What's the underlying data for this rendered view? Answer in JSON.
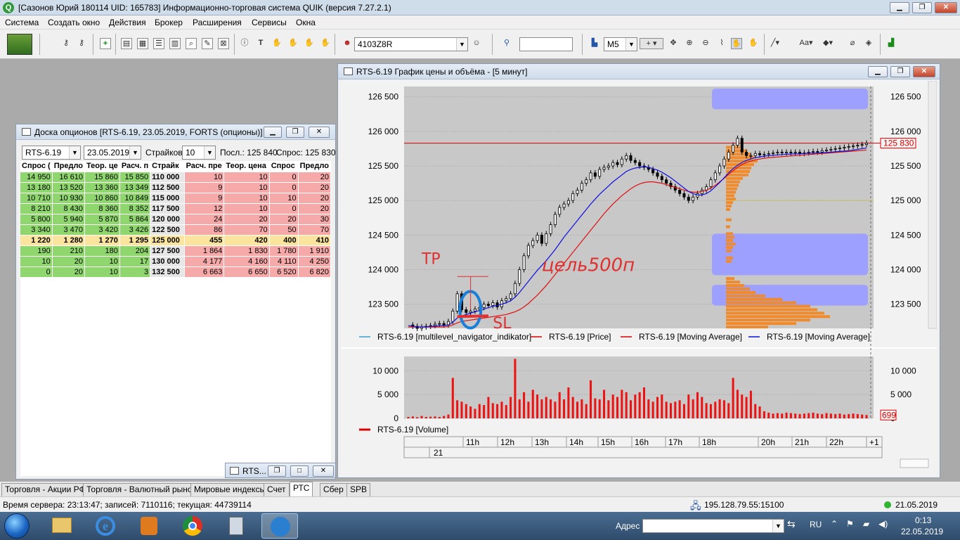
{
  "app": {
    "title": "[Сазонов Юрий 180114 UID: 165783] Информационно-торговая система QUIK (версия 7.27.2.1)"
  },
  "menu": [
    "Система",
    "Создать окно",
    "Действия",
    "Брокер",
    "Расширения",
    "Сервисы",
    "Окна"
  ],
  "toolbar": {
    "account": "4103Z8R",
    "interval": "M5",
    "search_value": ""
  },
  "options_board": {
    "title": "Доска опционов [RTS-6.19, 23.05.2019, FORTS (опционы)]",
    "instrument": "RTS-6.19",
    "expiry": "23.05.2019",
    "strikes_label": "Страйков:",
    "strikes_value": "10",
    "last_label": "Посл.: 125 840",
    "bid_label": "Спрос: 125 830",
    "headers": [
      "Спрос (",
      "Предло",
      "Теор. це",
      "Расч. п",
      "Страйк",
      "Расч. пре",
      "Теор. цена",
      "Спрос ",
      "Предло"
    ],
    "rows": [
      [
        "14 950",
        "16 610",
        "15 860",
        "15 850",
        "110 000",
        "10",
        "10",
        "0",
        "20"
      ],
      [
        "13 180",
        "13 520",
        "13 360",
        "13 349",
        "112 500",
        "9",
        "10",
        "0",
        "20"
      ],
      [
        "10 710",
        "10 930",
        "10 860",
        "10 849",
        "115 000",
        "9",
        "10",
        "10",
        "20"
      ],
      [
        "8 210",
        "8 430",
        "8 360",
        "8 352",
        "117 500",
        "12",
        "10",
        "0",
        "20"
      ],
      [
        "5 800",
        "5 940",
        "5 870",
        "5 864",
        "120 000",
        "24",
        "20",
        "20",
        "30"
      ],
      [
        "3 340",
        "3 470",
        "3 420",
        "3 426",
        "122 500",
        "86",
        "70",
        "50",
        "70"
      ],
      [
        "1 220",
        "1 280",
        "1 270",
        "1 295",
        "125 000",
        "455",
        "420",
        "400",
        "410"
      ],
      [
        "190",
        "210",
        "180",
        "204",
        "127 500",
        "1 864",
        "1 830",
        "1 780",
        "1 910"
      ],
      [
        "10",
        "20",
        "10",
        "17",
        "130 000",
        "4 177",
        "4 160",
        "4 110",
        "4 250"
      ],
      [
        "0",
        "20",
        "10",
        "3",
        "132 500",
        "6 663",
        "6 650",
        "6 520",
        "6 820"
      ]
    ]
  },
  "chart_window": {
    "title": "RTS-6.19 График цены и объёма - [5 минут]",
    "last_price_label": "125 830",
    "last_volume_label": "699",
    "legend_price": [
      "RTS-6.19 [multilevel_navigator_indikator]",
      "RTS-6.19 [Price]",
      "RTS-6.19 [Moving Average]",
      "RTS-6.19 [Moving Average]"
    ],
    "legend_volume": "RTS-6.19 [Volume]",
    "annotation_tp": "ТР",
    "annotation_sl": "SL",
    "annotation_target": "цель500п",
    "time_labels": [
      "11h",
      "12h",
      "13h",
      "14h",
      "15h",
      "16h",
      "17h",
      "18h",
      "20h",
      "21h",
      "22h",
      "+1"
    ],
    "date_label": "21",
    "colors": {
      "price": "#cc0000",
      "ma_fast": "#1010e0",
      "ma_slow": "#e01010",
      "volume": "#ee1111",
      "profile_orange": "#f08a2a",
      "profile_blue": "#9ea0ff"
    }
  },
  "chart_data": [
    {
      "type": "line",
      "ylim": [
        123150,
        126650
      ],
      "yticks": [
        "123 500",
        "124 000",
        "124 500",
        "125 000",
        "125 500",
        "126 000",
        "126 500"
      ],
      "series": [
        {
          "name": "RTS-6.19 [Price]",
          "values": [
            123200,
            123180,
            123150,
            123170,
            123180,
            123190,
            123210,
            123220,
            123200,
            123250,
            123400,
            123650,
            123420,
            123380,
            123400,
            123430,
            123450,
            123500,
            123480,
            123520,
            123460,
            123550,
            123580,
            123650,
            123800,
            124000,
            124200,
            124350,
            124420,
            124500,
            124380,
            124520,
            124650,
            124800,
            124900,
            124950,
            125000,
            125100,
            125150,
            125250,
            125300,
            125400,
            125350,
            125450,
            125480,
            125500,
            125550,
            125520,
            125600,
            125650,
            125580,
            125550,
            125500,
            125480,
            125450,
            125400,
            125350,
            125300,
            125250,
            125200,
            125150,
            125100,
            125050,
            125000,
            125050,
            125100,
            125150,
            125200,
            125300,
            125400,
            125500,
            125600,
            125700,
            125800,
            125900,
            125700,
            125650,
            125650,
            125680,
            125660,
            125670,
            125680,
            125690,
            125700,
            125690,
            125700,
            125690,
            125700,
            125680,
            125690,
            125700,
            125710,
            125700,
            125720,
            125730,
            125740,
            125750,
            125760,
            125770,
            125780,
            125790,
            125800,
            125810,
            125830
          ]
        },
        {
          "name": "RTS-6.19 [Moving Average]",
          "values": [
            123190,
            123180,
            123170,
            123170,
            123170,
            123180,
            123180,
            123190,
            123190,
            123200,
            123240,
            123300,
            123330,
            123350,
            123370,
            123390,
            123410,
            123430,
            123450,
            123470,
            123480,
            123500,
            123520,
            123550,
            123600,
            123670,
            123750,
            123830,
            123910,
            123990,
            124060,
            124130,
            124210,
            124290,
            124380,
            124470,
            124550,
            124630,
            124710,
            124790,
            124870,
            124950,
            125020,
            125090,
            125150,
            125210,
            125270,
            125320,
            125370,
            125420,
            125450,
            125470,
            125480,
            125490,
            125480,
            125460,
            125440,
            125410,
            125370,
            125330,
            125280,
            125230,
            125180,
            125130,
            125100,
            125080,
            125080,
            125100,
            125140,
            125200,
            125260,
            125330,
            125400,
            125460,
            125510,
            125550,
            125580,
            125600,
            125620,
            125630,
            125640,
            125650,
            125655,
            125660,
            125665,
            125670,
            125672,
            125675,
            125677,
            125680,
            125682,
            125685,
            125688,
            125690,
            125695,
            125700,
            125705,
            125710,
            125715,
            125720,
            125730,
            125740,
            125750,
            125760
          ]
        },
        {
          "name": "RTS-6.19 [Moving Average]",
          "values": [
            123170,
            123170,
            123170,
            123170,
            123170,
            123170,
            123170,
            123170,
            123170,
            123180,
            123200,
            123230,
            123250,
            123260,
            123270,
            123280,
            123290,
            123300,
            123310,
            123320,
            123330,
            123340,
            123350,
            123370,
            123390,
            123420,
            123460,
            123510,
            123570,
            123630,
            123700,
            123770,
            123850,
            123930,
            124010,
            124090,
            124170,
            124250,
            124330,
            124410,
            124490,
            124570,
            124650,
            124730,
            124810,
            124880,
            124950,
            125010,
            125070,
            125120,
            125170,
            125210,
            125240,
            125260,
            125270,
            125270,
            125260,
            125250,
            125230,
            125210,
            125190,
            125170,
            125150,
            125130,
            125120,
            125120,
            125130,
            125150,
            125180,
            125220,
            125270,
            125320,
            125380,
            125430,
            125480,
            125520,
            125550,
            125570,
            125590,
            125600,
            125610,
            125620,
            125625,
            125630,
            125635,
            125640,
            125645,
            125650,
            125655,
            125660,
            125665,
            125670,
            125675,
            125680,
            125685,
            125690,
            125695,
            125700,
            125705,
            125710,
            125715,
            125720,
            125725,
            125730
          ]
        }
      ]
    },
    {
      "type": "bar",
      "ylim": [
        0,
        13000
      ],
      "yticks": [
        "0",
        "5 000",
        "10 000"
      ],
      "series": [
        {
          "name": "RTS-6.19 [Volume]",
          "values": [
            300,
            400,
            250,
            500,
            300,
            350,
            400,
            300,
            500,
            800,
            8500,
            3800,
            3500,
            3000,
            2500,
            2000,
            3000,
            2800,
            4500,
            3200,
            3000,
            3500,
            2800,
            4500,
            12500,
            4000,
            5500,
            3500,
            6000,
            5000,
            4000,
            4500,
            4000,
            3500,
            5500,
            4000,
            6500,
            4500,
            3500,
            4000,
            3000,
            8000,
            4200,
            4000,
            6000,
            3800,
            5000,
            4500,
            6000,
            5500,
            3800,
            5000,
            5500,
            6500,
            4000,
            3500,
            4500,
            5000,
            3500,
            3200,
            3500,
            3800,
            3000,
            5000,
            4000,
            5500,
            4500,
            3200,
            3000,
            3500,
            4000,
            3800,
            3200,
            8500,
            6000,
            5000,
            4500,
            5800,
            3000,
            2500,
            1500,
            1200,
            1000,
            1100,
            1000,
            1200,
            1100,
            1000,
            900,
            1000,
            1100,
            1200,
            1000,
            900,
            1100,
            1000,
            900,
            1000,
            800,
            900,
            1000,
            900,
            800,
            699
          ]
        }
      ]
    }
  ],
  "tabs": [
    "Торговля - Акции РФ",
    "Торговля - Валютный рынок",
    "Мировые индексы",
    "Счет",
    "РТС",
    "Сбер",
    "SPB"
  ],
  "minimized_window": "RTS...",
  "status": {
    "server": "Время сервера: 23:13:47; записей: 7110116; текущая: 44739114",
    "connection": "195.128.79.55:15100",
    "date": "21.05.2019"
  },
  "taskbar": {
    "address_label": "Адрес",
    "lang": "RU",
    "time": "0:13",
    "date": "22.05.2019"
  }
}
